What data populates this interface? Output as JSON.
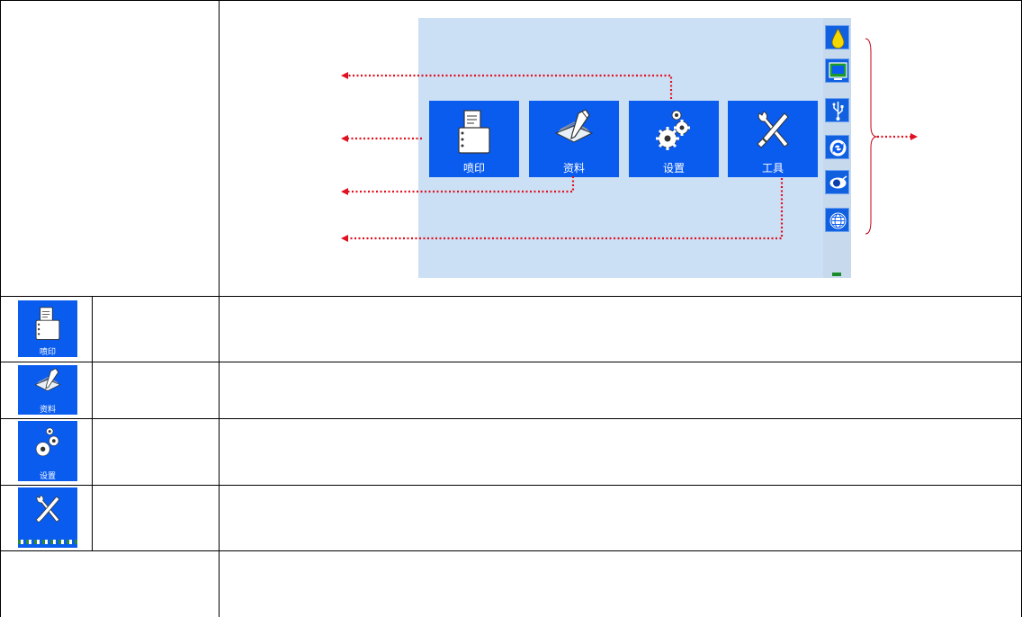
{
  "screen": {
    "tiles": [
      {
        "label": "喷印",
        "icon": "print-document-icon"
      },
      {
        "label": "资料",
        "icon": "data-pen-icon"
      },
      {
        "label": "设置",
        "icon": "settings-gears-icon"
      },
      {
        "label": "工具",
        "icon": "tools-icon"
      }
    ],
    "side_icons": [
      "ink-drop-icon",
      "monitor-icon",
      "usb-icon",
      "refresh-icon",
      "eye-icon",
      "globe-icon"
    ]
  },
  "rows": [
    {
      "label": "喷印",
      "icon": "print-document-icon"
    },
    {
      "label": "资料",
      "icon": "data-pen-icon"
    },
    {
      "label": "设置",
      "icon": "settings-gears-icon"
    },
    {
      "label": "",
      "icon": "tools-icon"
    }
  ],
  "colors": {
    "tile_blue": "#0a5cef",
    "screen_bg": "#cce0f5",
    "annotation_red": "#e01020",
    "drop_yellow": "#f5d800"
  }
}
